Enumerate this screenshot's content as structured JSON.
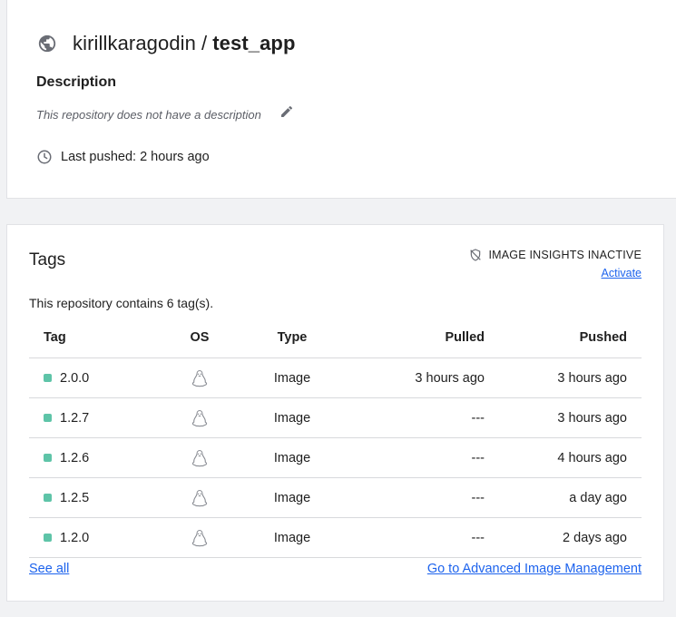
{
  "repo": {
    "owner": "kirillkaragodin",
    "separator": "/",
    "name": "test_app",
    "description_heading": "Description",
    "description_text": "This repository does not have a description",
    "last_pushed": "Last pushed: 2 hours ago"
  },
  "tags_section": {
    "title": "Tags",
    "insights_status": "IMAGE INSIGHTS INACTIVE",
    "activate_label": "Activate",
    "count_text": "This repository contains 6 tag(s).",
    "columns": [
      "Tag",
      "OS",
      "Type",
      "Pulled",
      "Pushed"
    ],
    "rows": [
      {
        "tag": "2.0.0",
        "os": "linux-icon",
        "type": "Image",
        "pulled": "3 hours ago",
        "pushed": "3 hours ago"
      },
      {
        "tag": "1.2.7",
        "os": "linux-icon",
        "type": "Image",
        "pulled": "---",
        "pushed": "3 hours ago"
      },
      {
        "tag": "1.2.6",
        "os": "linux-icon",
        "type": "Image",
        "pulled": "---",
        "pushed": "4 hours ago"
      },
      {
        "tag": "1.2.5",
        "os": "linux-icon",
        "type": "Image",
        "pulled": "---",
        "pushed": "a day ago"
      },
      {
        "tag": "1.2.0",
        "os": "linux-icon",
        "type": "Image",
        "pulled": "---",
        "pushed": "2 days ago"
      }
    ],
    "see_all_label": "See all",
    "advanced_label": "Go to Advanced Image Management"
  },
  "colors": {
    "link": "#1d63ed",
    "tag_dot": "#5ec4a8",
    "background": "#f1f2f4"
  }
}
